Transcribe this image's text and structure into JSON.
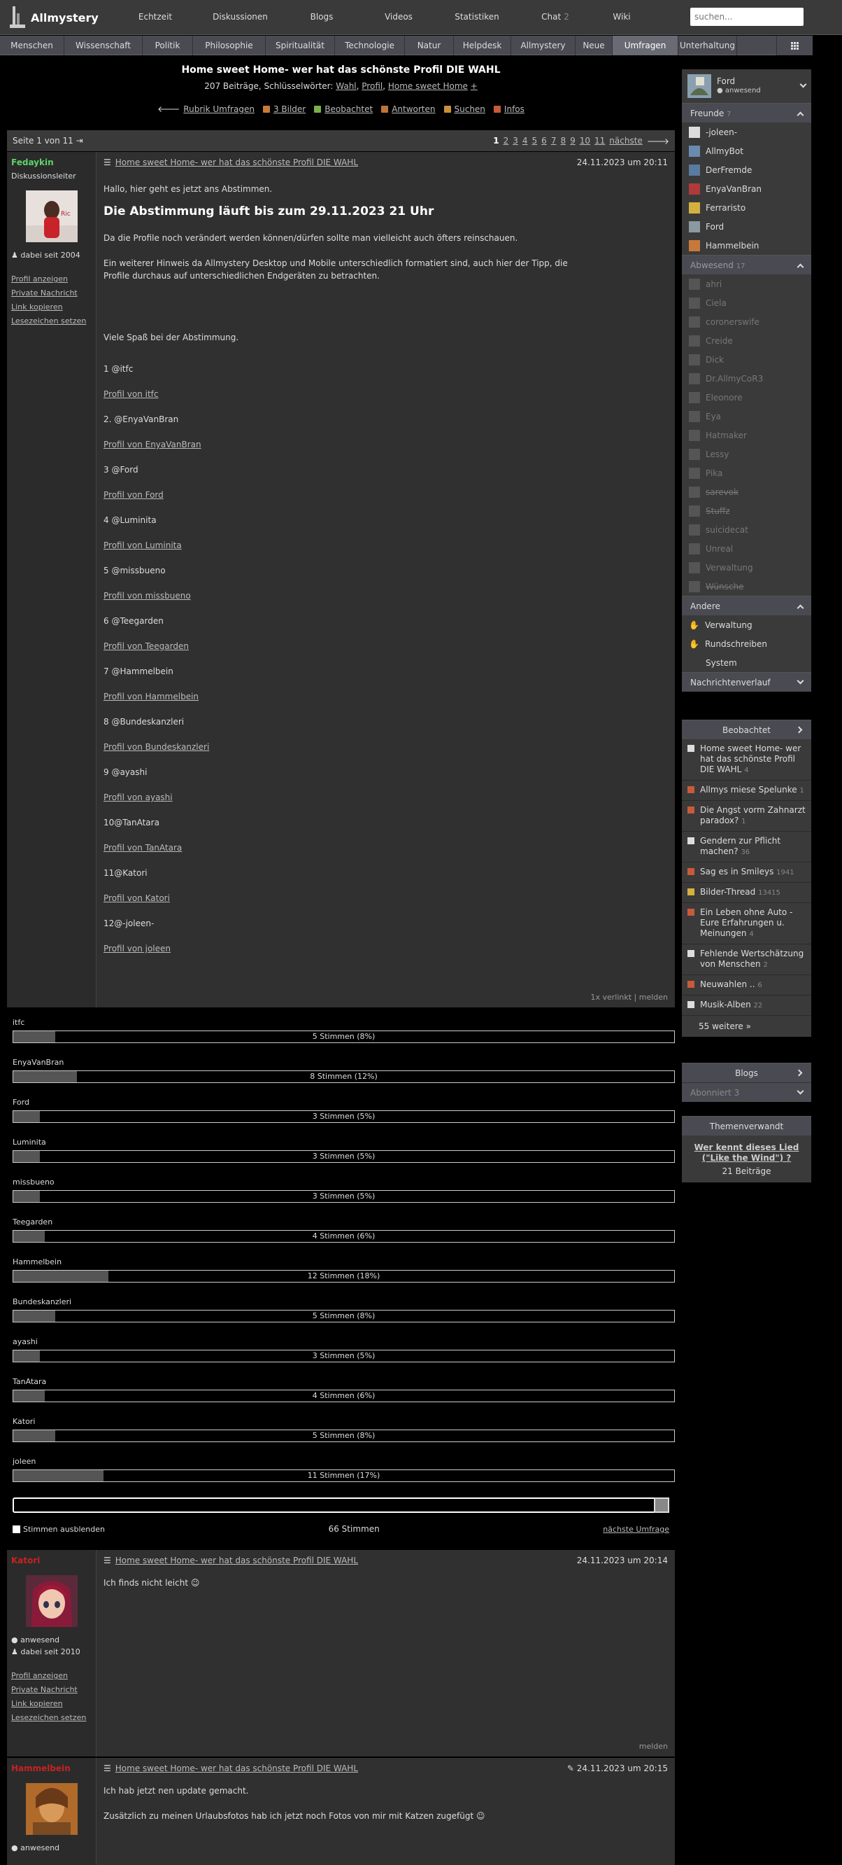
{
  "topbar": {
    "logo_text": "Allmystery",
    "nav": [
      "Echtzeit",
      "Diskussionen",
      "Blogs",
      "Videos",
      "Statistiken",
      "Chat",
      "Wiki"
    ],
    "chat_count": "2",
    "search_placeholder": "suchen..."
  },
  "categories": [
    "Menschen",
    "Wissenschaft",
    "Politik",
    "Philosophie",
    "Spiritualität",
    "Technologie",
    "Natur",
    "Helpdesk",
    "Allmystery",
    "Neue",
    "Umfragen",
    "Unterhaltung"
  ],
  "active_category": "Umfragen",
  "thread": {
    "title": "Home sweet Home- wer hat das schönste Profil DIE WAHL",
    "meta_prefix": "207 Beiträge, Schlüsselwörter:",
    "keywords": [
      "Wahl",
      "Profil",
      "Home sweet Home"
    ],
    "plus": "+",
    "links": [
      "Rubrik Umfragen",
      "3 Bilder",
      "Beobachtet",
      "Antworten",
      "Suchen",
      "Infos"
    ]
  },
  "pager": {
    "label": "Seite 1 von 11",
    "pages": [
      "1",
      "2",
      "3",
      "4",
      "5",
      "6",
      "7",
      "8",
      "9",
      "10",
      "11"
    ],
    "next": "nächste"
  },
  "post1": {
    "author": "Fedaykin",
    "role": "Diskussionsleiter",
    "since": "dabei seit 2004",
    "links": [
      "Profil anzeigen",
      "Private Nachricht",
      "Link kopieren",
      "Lesezeichen setzen"
    ],
    "title": "Home sweet Home- wer hat das schönste Profil DIE WAHL",
    "date": "24.11.2023 um 20:11",
    "intro": "Hallo, hier geht es jetzt ans Abstimmen.",
    "headline": "Die Abstimmung läuft bis zum 29.11.2023 21 Uhr",
    "p1": "Da die Profile noch verändert werden können/dürfen sollte man vielleicht auch öfters reinschauen.",
    "p2": "Ein weiterer Hinweis da Allmystery Desktop und Mobile unterschiedlich formatiert sind, auch hier der Tipp, die Profile durchaus auf unterschiedlichen Endgeräten zu betrachten.",
    "p3": "Viele Spaß bei der Abstimmung.",
    "entries": [
      {
        "num": "1 @itfc",
        "link": "Profil von itfc"
      },
      {
        "num": "2. @EnyaVanBran",
        "link": "Profil von EnyaVanBran"
      },
      {
        "num": "3 @Ford",
        "link": "Profil von Ford"
      },
      {
        "num": "4 @Luminita",
        "link": "Profil von Luminita"
      },
      {
        "num": "5 @missbueno",
        "link": "Profil von missbueno"
      },
      {
        "num": "6 @Teegarden",
        "link": "Profil von Teegarden"
      },
      {
        "num": "7 @Hammelbein",
        "link": "Profil von Hammelbein"
      },
      {
        "num": "8 @Bundeskanzleri",
        "link": "Profil von Bundeskanzleri"
      },
      {
        "num": "9 @ayashi",
        "link": "Profil von ayashi"
      },
      {
        "num": "10@TanAtara",
        "link": "Profil von TanAtara"
      },
      {
        "num": "11@Katori",
        "link": "Profil von Katori"
      },
      {
        "num": "12@-joleen-",
        "link": "Profil von joleen"
      }
    ],
    "footer": "1x verlinkt  |  melden"
  },
  "poll": {
    "options": [
      {
        "name": "itfc",
        "label": "5 Stimmen (8%)",
        "pct": 8
      },
      {
        "name": "EnyaVanBran",
        "label": "8 Stimmen (12%)",
        "pct": 12
      },
      {
        "name": "Ford",
        "label": "3 Stimmen (5%)",
        "pct": 5
      },
      {
        "name": "Luminita",
        "label": "3 Stimmen (5%)",
        "pct": 5
      },
      {
        "name": "missbueno",
        "label": "3 Stimmen (5%)",
        "pct": 5
      },
      {
        "name": "Teegarden",
        "label": "4 Stimmen (6%)",
        "pct": 6
      },
      {
        "name": "Hammelbein",
        "label": "12 Stimmen (18%)",
        "pct": 18
      },
      {
        "name": "Bundeskanzleri",
        "label": "5 Stimmen (8%)",
        "pct": 8
      },
      {
        "name": "ayashi",
        "label": "3 Stimmen (5%)",
        "pct": 5
      },
      {
        "name": "TanAtara",
        "label": "4 Stimmen (6%)",
        "pct": 6
      },
      {
        "name": "Katori",
        "label": "5 Stimmen (8%)",
        "pct": 8
      },
      {
        "name": "joleen",
        "label": "11 Stimmen (17%)",
        "pct": 17
      }
    ],
    "hide_label": "Stimmen ausblenden",
    "total": "66 Stimmen",
    "next": "nächste Umfrage"
  },
  "post2": {
    "author": "Katori",
    "online": "anwesend",
    "since": "dabei seit 2010",
    "links": [
      "Profil anzeigen",
      "Private Nachricht",
      "Link kopieren",
      "Lesezeichen setzen"
    ],
    "title": "Home sweet Home- wer hat das schönste Profil DIE WAHL",
    "date": "24.11.2023 um 20:14",
    "text": "Ich finds nicht leicht",
    "footer": "melden"
  },
  "post3": {
    "author": "Hammelbein",
    "online": "anwesend",
    "title": "Home sweet Home- wer hat das schönste Profil DIE WAHL",
    "date": "24.11.2023 um 20:15",
    "text1": "Ich hab jetzt nen update gemacht.",
    "text2": "Zusätzlich zu meinen Urlaubsfotos hab ich jetzt noch Fotos von mir mit Katzen zugefügt"
  },
  "sidebar": {
    "user": "Ford",
    "user_status": "anwesend",
    "friends_label": "Freunde",
    "friends_count": "7",
    "friends": [
      "-joleen-",
      "AllmyBot",
      "DerFremde",
      "EnyaVanBran",
      "Ferraristo",
      "Ford",
      "Hammelbein"
    ],
    "absent_label": "Abwesend",
    "absent_count": "17",
    "absent": [
      "ahri",
      "Ciela",
      "coronerswife",
      "Creide",
      "Dick",
      "Dr.AllmyCoR3",
      "Eleonore",
      "Eya",
      "Hatmaker",
      "Lessy",
      "Pika",
      "sarevok",
      "Stuffz",
      "suicidecat",
      "Unreal",
      "Verwaltung",
      "Wünsche"
    ],
    "other_label": "Andere",
    "other": [
      "Verwaltung",
      "Rundschreiben",
      "System"
    ],
    "history_label": "Nachrichtenverlauf",
    "watched_label": "Beobachtet",
    "watched": [
      {
        "t": "Home sweet Home- wer hat das schönste Profil DIE WAHL",
        "c": "4"
      },
      {
        "t": "Allmys miese Spelunke",
        "c": "1"
      },
      {
        "t": "Die Angst vorm Zahnarzt paradox?",
        "c": "1"
      },
      {
        "t": "Gendern zur Pflicht machen?",
        "c": "36"
      },
      {
        "t": "Sag es in Smileys",
        "c": "1941"
      },
      {
        "t": "Bilder-Thread",
        "c": "13415"
      },
      {
        "t": "Ein Leben ohne Auto - Eure Erfahrungen u. Meinungen",
        "c": "4"
      },
      {
        "t": "Fehlende Wertschätzung von Menschen",
        "c": "2"
      },
      {
        "t": "Neuwahlen ..",
        "c": "6"
      },
      {
        "t": "Musik-Alben",
        "c": "22"
      }
    ],
    "more": "55 weitere »",
    "blogs_label": "Blogs",
    "subscribed_label": "Abonniert",
    "subscribed_count": "3",
    "related_label": "Themenverwandt",
    "related_title": "Wer kennt dieses Lied (\"Like the Wind\") ?",
    "related_count": "21 Beiträge"
  }
}
